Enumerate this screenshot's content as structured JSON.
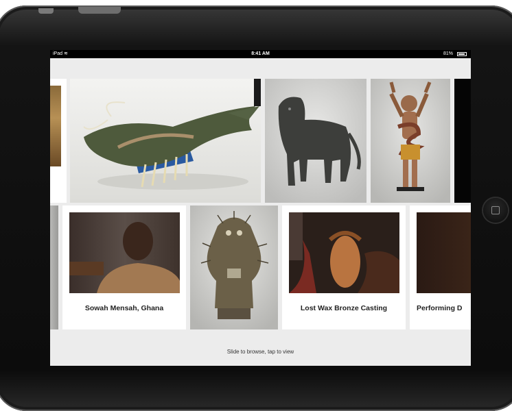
{
  "statusbar": {
    "device": "iPad",
    "time": "8:41 AM",
    "battery": "81%"
  },
  "gallery": {
    "row1": [
      {
        "name": "partial-artwork-left"
      },
      {
        "name": "lobster-sculpture"
      },
      {
        "name": "leopard-sculpture"
      },
      {
        "name": "figure-with-snake-sculpture"
      },
      {
        "name": "partial-artwork-right"
      }
    ],
    "row2": [
      {
        "name": "partial-artwork-left-2"
      },
      {
        "name": "video-sowah-mensah",
        "caption": "Sowah Mensah, Ghana"
      },
      {
        "name": "nail-figure-sculpture"
      },
      {
        "name": "video-lost-wax",
        "caption": "Lost Wax Bronze Casting"
      },
      {
        "name": "video-performing",
        "caption": "Performing D"
      }
    ]
  },
  "footer": {
    "hint": "Slide to browse, tap to view"
  }
}
